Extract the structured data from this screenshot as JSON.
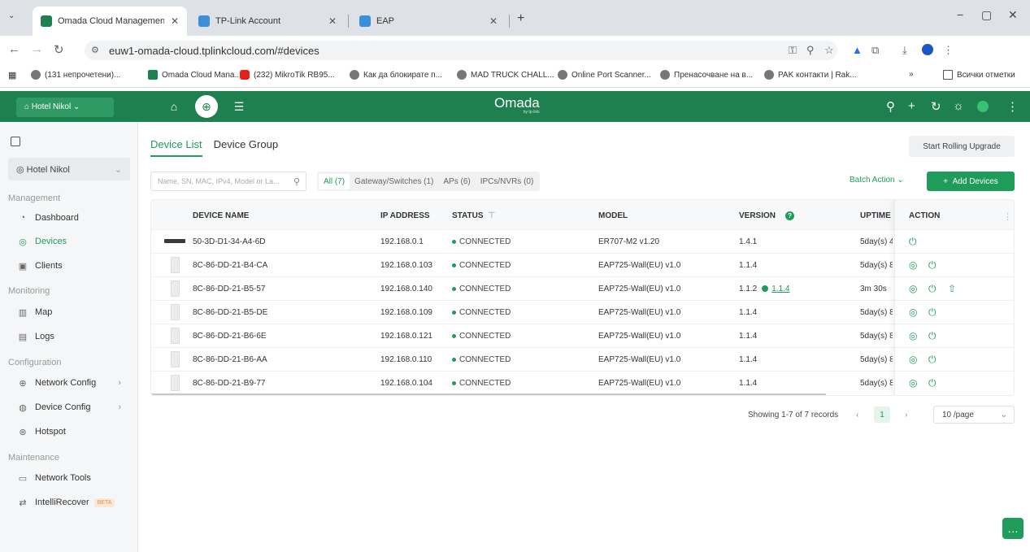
{
  "browser": {
    "tabs": [
      {
        "title": "Omada Cloud Management Pla",
        "close": "✕",
        "favicon_color": "#1e7f4f"
      },
      {
        "title": "TP-Link Account",
        "close": "✕",
        "favicon_color": "#3b8fd9"
      },
      {
        "title": "EAP",
        "close": "✕",
        "favicon_color": "#3b8fd9"
      }
    ],
    "new_tab": "+",
    "url": "euw1-omada-cloud.tplinkcloud.com/#devices",
    "bookmarks": [
      {
        "label": "(131 непрочетени)...",
        "color": "#777"
      },
      {
        "label": "Omada Cloud Mana...",
        "color": "#1e7f4f"
      },
      {
        "label": "(232) MikroTik RB95...",
        "color": "#e62117"
      },
      {
        "label": "Как да блокирате п...",
        "color": "#777"
      },
      {
        "label": "MAD TRUCK CHALL...",
        "color": "#777"
      },
      {
        "label": "Online Port Scanner...",
        "color": "#777"
      },
      {
        "label": "Пренасочване на в...",
        "color": "#777"
      },
      {
        "label": "PAK контакти | Rak...",
        "color": "#777"
      }
    ],
    "bookmarks_more": "»",
    "all_bookmarks": "Всички отметки"
  },
  "header": {
    "site": "Hotel Nikol",
    "brand": "Omada",
    "brand_sub": "by tp-link",
    "accent": "#1e7f4f"
  },
  "sidebar": {
    "site": "Hotel Nikol",
    "sections": {
      "management": "Management",
      "monitoring": "Monitoring",
      "configuration": "Configuration",
      "maintenance": "Maintenance"
    },
    "items": {
      "dashboard": "Dashboard",
      "devices": "Devices",
      "clients": "Clients",
      "map": "Map",
      "logs": "Logs",
      "network_config": "Network Config",
      "device_config": "Device Config",
      "hotspot": "Hotspot",
      "network_tools": "Network Tools",
      "intellirecover": "IntelliRecover",
      "beta": "BETA"
    }
  },
  "main": {
    "tabs": {
      "device_list": "Device List",
      "device_group": "Device Group"
    },
    "rolling_upgrade": "Start Rolling Upgrade",
    "search_placeholder": "Name, SN, MAC, IPv4, Model or La...",
    "filters": {
      "all": "All (7)",
      "gateway": "Gateway/Switches (1)",
      "aps": "APs (6)",
      "ipcs": "IPCs/NVRs (0)"
    },
    "batch_action": "Batch Action",
    "add_devices": "Add Devices",
    "columns": {
      "name": "DEVICE NAME",
      "ip": "IP ADDRESS",
      "status": "STATUS",
      "model": "MODEL",
      "version": "VERSION",
      "uptime": "UPTIME",
      "action": "ACTION"
    },
    "rows": [
      {
        "name": "50-3D-D1-34-A4-6D",
        "ip": "192.168.0.1",
        "status": "CONNECTED",
        "model": "ER707-M2 v1.20",
        "version": "1.4.1",
        "update": "",
        "uptime": "5day(s) 4"
      },
      {
        "name": "8C-86-DD-21-B4-CA",
        "ip": "192.168.0.103",
        "status": "CONNECTED",
        "model": "EAP725-Wall(EU) v1.0",
        "version": "1.1.4",
        "update": "",
        "uptime": "5day(s) 8"
      },
      {
        "name": "8C-86-DD-21-B5-57",
        "ip": "192.168.0.140",
        "status": "CONNECTED",
        "model": "EAP725-Wall(EU) v1.0",
        "version": "1.1.2",
        "update": "1.1.4",
        "uptime": "3m 30s"
      },
      {
        "name": "8C-86-DD-21-B5-DE",
        "ip": "192.168.0.109",
        "status": "CONNECTED",
        "model": "EAP725-Wall(EU) v1.0",
        "version": "1.1.4",
        "update": "",
        "uptime": "5day(s) 8"
      },
      {
        "name": "8C-86-DD-21-B6-6E",
        "ip": "192.168.0.121",
        "status": "CONNECTED",
        "model": "EAP725-Wall(EU) v1.0",
        "version": "1.1.4",
        "update": "",
        "uptime": "5day(s) 8"
      },
      {
        "name": "8C-86-DD-21-B6-AA",
        "ip": "192.168.0.110",
        "status": "CONNECTED",
        "model": "EAP725-Wall(EU) v1.0",
        "version": "1.1.4",
        "update": "",
        "uptime": "5day(s) 8"
      },
      {
        "name": "8C-86-DD-21-B9-77",
        "ip": "192.168.0.104",
        "status": "CONNECTED",
        "model": "EAP725-Wall(EU) v1.0",
        "version": "1.1.4",
        "update": "",
        "uptime": "5day(s) 8"
      }
    ],
    "pagination": {
      "showing": "Showing 1-7 of 7 records",
      "page": "1",
      "per_page": "10 /page"
    }
  }
}
